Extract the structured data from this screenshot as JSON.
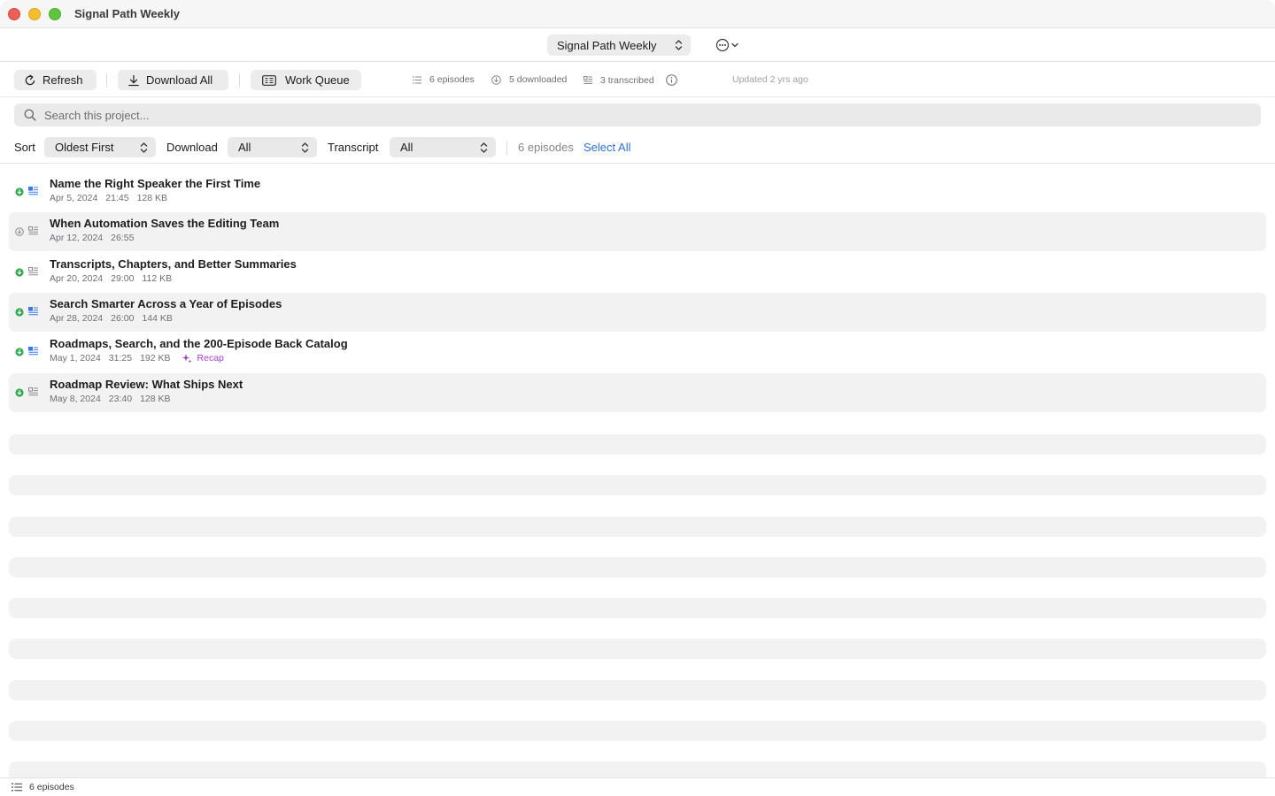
{
  "window": {
    "title": "Signal Path Weekly"
  },
  "project_bar": {
    "selected_project": "Signal Path Weekly",
    "more_icon": "ellipsis-circle-icon"
  },
  "toolbar": {
    "refresh_label": "Refresh",
    "download_all_label": "Download All",
    "work_queue_label": "Work Queue",
    "episodes_stat": "6 episodes",
    "downloaded_stat": "5 downloaded",
    "transcribed_stat": "3 transcribed",
    "updated": "Updated 2 yrs ago"
  },
  "search": {
    "placeholder": "Search this project...",
    "value": ""
  },
  "filters": {
    "sort_label": "Sort",
    "sort_value": "Oldest First",
    "download_label": "Download",
    "download_value": "All",
    "transcript_label": "Transcript",
    "transcript_value": "All",
    "count": "6 episodes",
    "select_all": "Select All"
  },
  "colors": {
    "downloaded": "#34a853",
    "transcribed": "#3b78e7",
    "recap": "#a23ec9",
    "link": "#2f6fd8"
  },
  "episodes": [
    {
      "title": "Name the Right Speaker the First Time",
      "date": "Apr 5, 2024",
      "duration": "21:45",
      "size": "128 KB",
      "downloaded": true,
      "transcribed": true,
      "recap": ""
    },
    {
      "title": "When Automation Saves the Editing Team",
      "date": "Apr 12, 2024",
      "duration": "26:55",
      "size": "",
      "downloaded": false,
      "transcribed": false,
      "recap": ""
    },
    {
      "title": "Transcripts, Chapters, and Better Summaries",
      "date": "Apr 20, 2024",
      "duration": "29:00",
      "size": "112 KB",
      "downloaded": true,
      "transcribed": false,
      "recap": ""
    },
    {
      "title": "Search Smarter Across a Year of Episodes",
      "date": "Apr 28, 2024",
      "duration": "26:00",
      "size": "144 KB",
      "downloaded": true,
      "transcribed": true,
      "recap": ""
    },
    {
      "title": "Roadmaps, Search, and the 200-Episode Back Catalog",
      "date": "May 1, 2024",
      "duration": "31:25",
      "size": "192 KB",
      "downloaded": true,
      "transcribed": true,
      "recap": "Recap"
    },
    {
      "title": "Roadmap Review: What Ships Next",
      "date": "May 8, 2024",
      "duration": "23:40",
      "size": "128 KB",
      "downloaded": true,
      "transcribed": false,
      "recap": ""
    }
  ],
  "status_bar": {
    "text": "6 episodes"
  }
}
